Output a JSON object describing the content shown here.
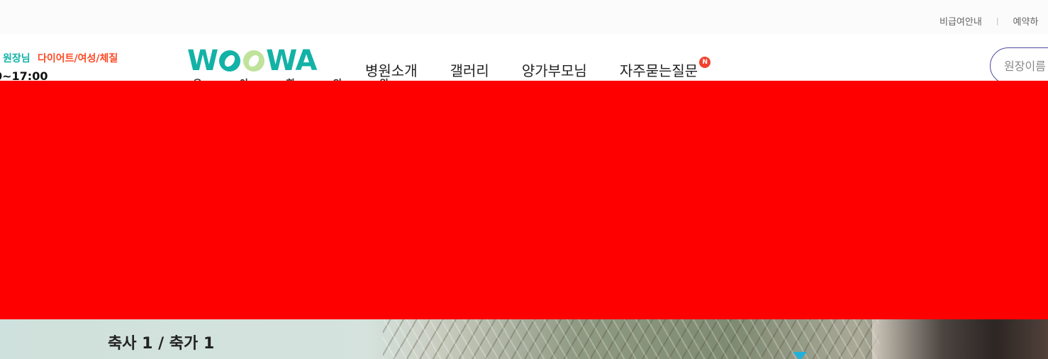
{
  "topbar": {
    "links": [
      "비급여안내",
      "예약하"
    ],
    "separator": "|"
  },
  "doctor": {
    "name": "원장님",
    "specialty": "다이어트/여성/체질",
    "hours": "0~17:00",
    "colors": {
      "name": "#12b3a8",
      "specialty": "#ff4a24"
    }
  },
  "logo": {
    "text_left": "W",
    "text_right": "WA",
    "subtitle": "우 아 한 의 원",
    "brand_color": "#13b2a6"
  },
  "nav": {
    "items": [
      "병원소개",
      "갤러리",
      "양가부모님",
      "자주묻는질문"
    ],
    "badge": "N",
    "badge_color": "#f2422e"
  },
  "search": {
    "placeholder": "원장이름"
  },
  "hero": {
    "caption": "축사 1 / 축가 1",
    "marker_color": "#21b0d8"
  },
  "redaction": {
    "color": "#ff0000"
  }
}
